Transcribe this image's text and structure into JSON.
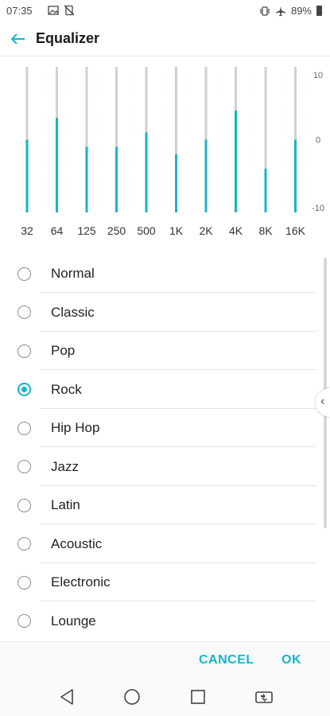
{
  "status_bar": {
    "time": "07:35",
    "battery_text": "89%",
    "left_icons": [
      "image-icon",
      "no-sync-icon"
    ],
    "right_icons": [
      "vibrate-icon",
      "airplane-icon",
      "battery-icon"
    ]
  },
  "header": {
    "title": "Equalizer",
    "back_icon": "arrow-left-icon"
  },
  "chart_data": {
    "type": "bar",
    "categories": [
      "32",
      "64",
      "125",
      "250",
      "500",
      "1K",
      "2K",
      "4K",
      "8K",
      "16K"
    ],
    "values": [
      0,
      3,
      -1,
      -1,
      1,
      -2,
      0,
      4,
      -4,
      0
    ],
    "ylim": [
      -10,
      10
    ],
    "yticks": [
      "10",
      "0",
      "-10"
    ],
    "accent_color": "#17b4c6",
    "track_color": "#d0d0d0"
  },
  "presets": {
    "items": [
      {
        "label": "Normal",
        "selected": false
      },
      {
        "label": "Classic",
        "selected": false
      },
      {
        "label": "Pop",
        "selected": false
      },
      {
        "label": "Rock",
        "selected": true
      },
      {
        "label": "Hip Hop",
        "selected": false
      },
      {
        "label": "Jazz",
        "selected": false
      },
      {
        "label": "Latin",
        "selected": false
      },
      {
        "label": "Acoustic",
        "selected": false
      },
      {
        "label": "Electronic",
        "selected": false
      },
      {
        "label": "Lounge",
        "selected": false
      }
    ]
  },
  "actions": {
    "cancel_label": "CANCEL",
    "ok_label": "OK"
  },
  "nav": {
    "icons": [
      "back-triangle-icon",
      "home-circle-icon",
      "recents-square-icon",
      "dual-window-icon"
    ]
  }
}
